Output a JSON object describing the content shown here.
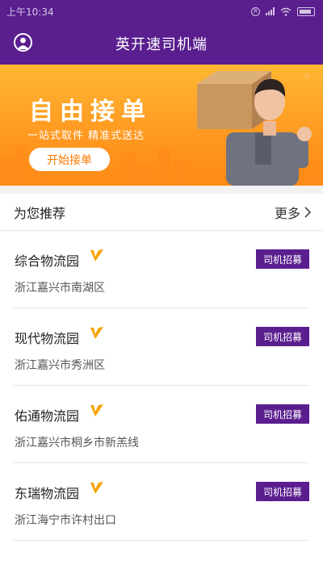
{
  "status": {
    "time": "上午10:34"
  },
  "header": {
    "title": "英开速司机端"
  },
  "banner": {
    "title": "自由接单",
    "subtitle": "一站式取件 精准式送达",
    "button_label": "开始接单"
  },
  "recommend": {
    "title": "为您推荐",
    "more_label": "更多"
  },
  "items": [
    {
      "name": "综合物流园",
      "address": "浙江嘉兴市南湖区",
      "button": "司机招募"
    },
    {
      "name": "现代物流园",
      "address": "浙江嘉兴市秀洲区",
      "button": "司机招募"
    },
    {
      "name": "佑通物流园",
      "address": "浙江嘉兴市桐乡市新羔线",
      "button": "司机招募"
    },
    {
      "name": "东瑞物流园",
      "address": "浙江海宁市许村出口",
      "button": "司机招募"
    }
  ],
  "colors": {
    "primary": "#5a1e8f",
    "banner": "#ff9820",
    "verified": "#f5a300"
  }
}
